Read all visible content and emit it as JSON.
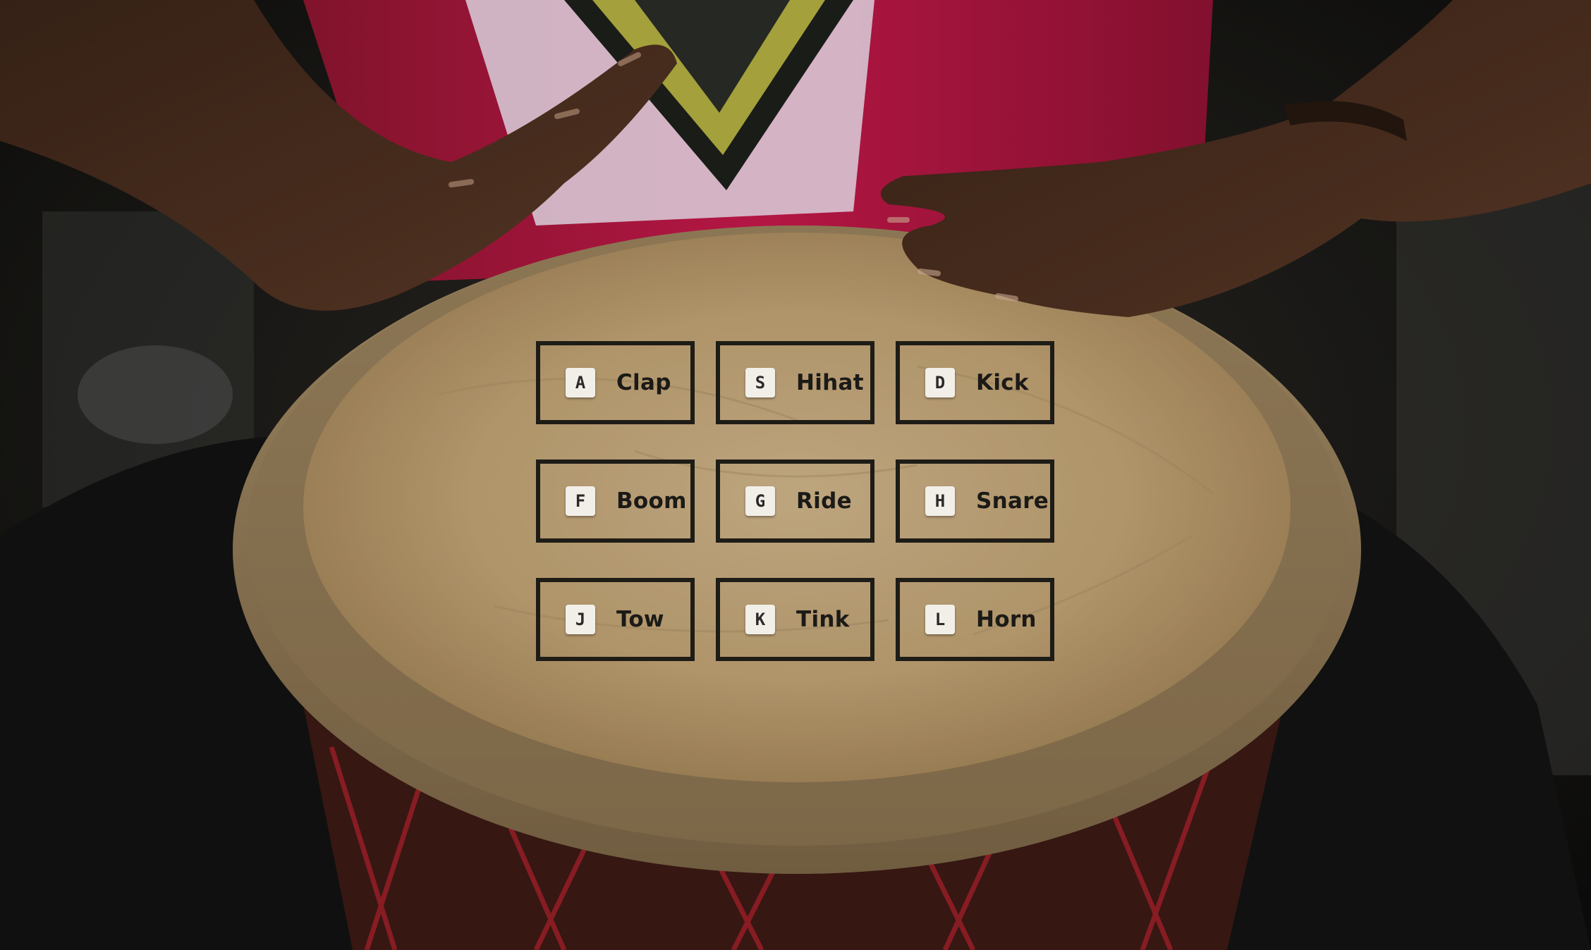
{
  "pads": [
    {
      "key": "A",
      "sound": "Clap"
    },
    {
      "key": "S",
      "sound": "Hihat"
    },
    {
      "key": "D",
      "sound": "Kick"
    },
    {
      "key": "F",
      "sound": "Boom"
    },
    {
      "key": "G",
      "sound": "Ride"
    },
    {
      "key": "H",
      "sound": "Snare"
    },
    {
      "key": "J",
      "sound": "Tow"
    },
    {
      "key": "K",
      "sound": "Tink"
    },
    {
      "key": "L",
      "sound": "Horn"
    }
  ],
  "colors": {
    "pad_border": "#1e1c16",
    "keycap_bg": "#f2efe9",
    "label_text": "#1b1a17",
    "drum_skin": "#c2a67a"
  }
}
